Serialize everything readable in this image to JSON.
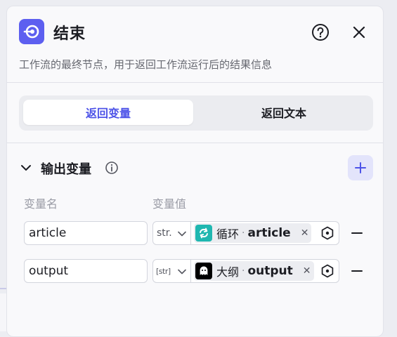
{
  "header": {
    "title": "结束",
    "description": "工作流的最终节点，用于返回工作流运行后的结果信息"
  },
  "tabs": [
    {
      "label": "返回变量",
      "active": true
    },
    {
      "label": "返回文本",
      "active": false
    }
  ],
  "section": {
    "title": "输出变量"
  },
  "columns": {
    "name": "变量名",
    "value": "变量值"
  },
  "rows": [
    {
      "name": "article",
      "type": "str.",
      "node": "循环",
      "sep": "·",
      "var": "article",
      "node_icon": "loop-icon",
      "icon_color": "#1fb7b0"
    },
    {
      "name": "output",
      "type": "[str]",
      "node": "大纲",
      "sep": "·",
      "var": "output",
      "node_icon": "ghost-icon",
      "icon_color": "#000000"
    }
  ],
  "colors": {
    "accent": "#4d53e8",
    "node_icon_bg": "#5d5ff0"
  }
}
